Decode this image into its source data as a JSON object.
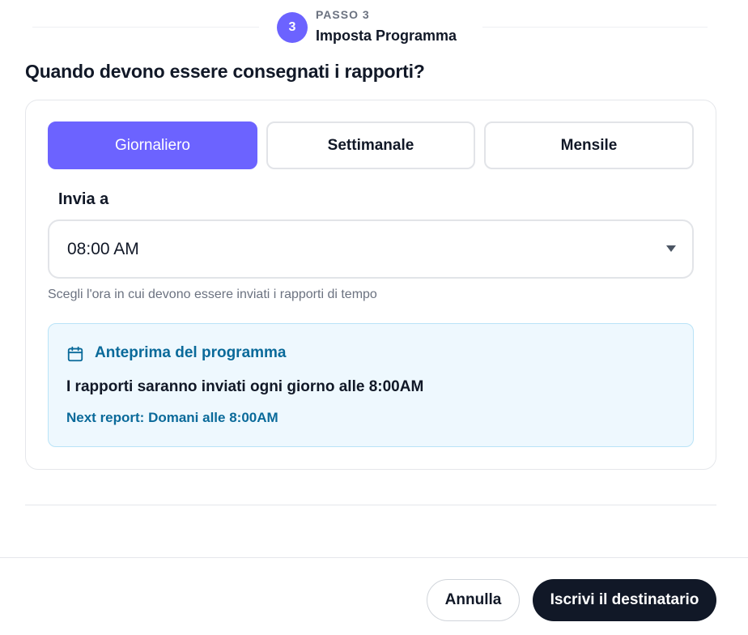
{
  "step": {
    "number": "3",
    "label": "PASSO 3",
    "title": "Imposta Programma"
  },
  "question": "Quando devono essere consegnati i rapporti?",
  "frequency": {
    "options": [
      "Giornaliero",
      "Settimanale",
      "Mensile"
    ],
    "selected": "Giornaliero"
  },
  "send_at": {
    "label": "Invia a",
    "value": "08:00 AM",
    "helper": "Scegli l'ora in cui devono essere inviati i rapporti di tempo"
  },
  "preview": {
    "icon": "calendar-icon",
    "title": "Anteprima del programma",
    "text": "I rapporti saranno inviati ogni giorno alle 8:00AM",
    "next": "Next report: Domani alle 8:00AM"
  },
  "footer": {
    "cancel_label": "Annulla",
    "submit_label": "Iscrivi il destinatario"
  },
  "colors": {
    "accent": "#6c63ff",
    "preview_bg": "#eef8fe",
    "preview_text": "#0a6a9a",
    "primary_button": "#111827"
  }
}
